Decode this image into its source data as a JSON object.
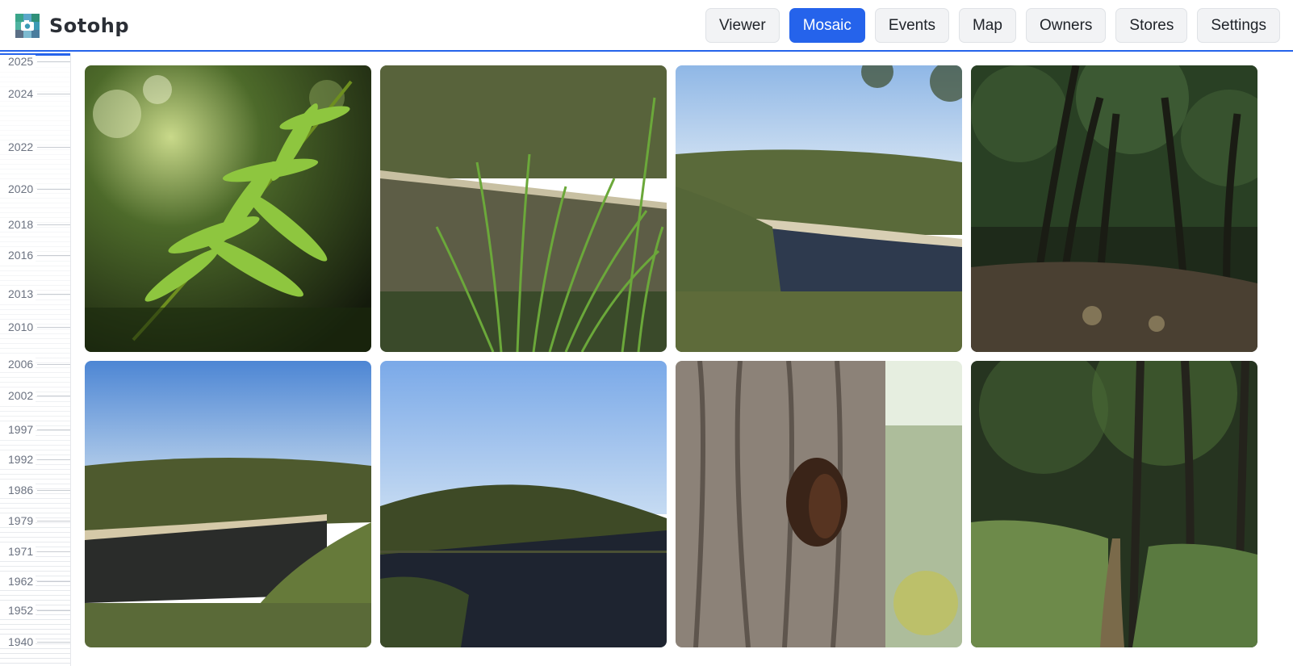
{
  "app": {
    "name": "Sotohp",
    "logo_icon": "camera-logo-icon"
  },
  "nav": {
    "active": "Mosaic",
    "items": [
      {
        "label": "Viewer"
      },
      {
        "label": "Mosaic"
      },
      {
        "label": "Events"
      },
      {
        "label": "Map"
      },
      {
        "label": "Owners"
      },
      {
        "label": "Stores"
      },
      {
        "label": "Settings"
      }
    ]
  },
  "timeline": {
    "years": [
      "2025",
      "2024",
      "2022",
      "2020",
      "2018",
      "2016",
      "2013",
      "2010",
      "2006",
      "2002",
      "1997",
      "1992",
      "1986",
      "1979",
      "1971",
      "1962",
      "1952",
      "1940"
    ]
  },
  "mosaic": {
    "photos": [
      {
        "subject": "fern"
      },
      {
        "subject": "grass-over-lake"
      },
      {
        "subject": "lake-under-blue-sky"
      },
      {
        "subject": "dark-forest-path"
      },
      {
        "subject": "river-bend"
      },
      {
        "subject": "lake-with-wooded-hill"
      },
      {
        "subject": "tree-trunk-with-hole"
      },
      {
        "subject": "forest-trail"
      }
    ]
  },
  "colors": {
    "accent": "#2563eb",
    "text": "#1f2329",
    "muted": "#6b7280"
  }
}
